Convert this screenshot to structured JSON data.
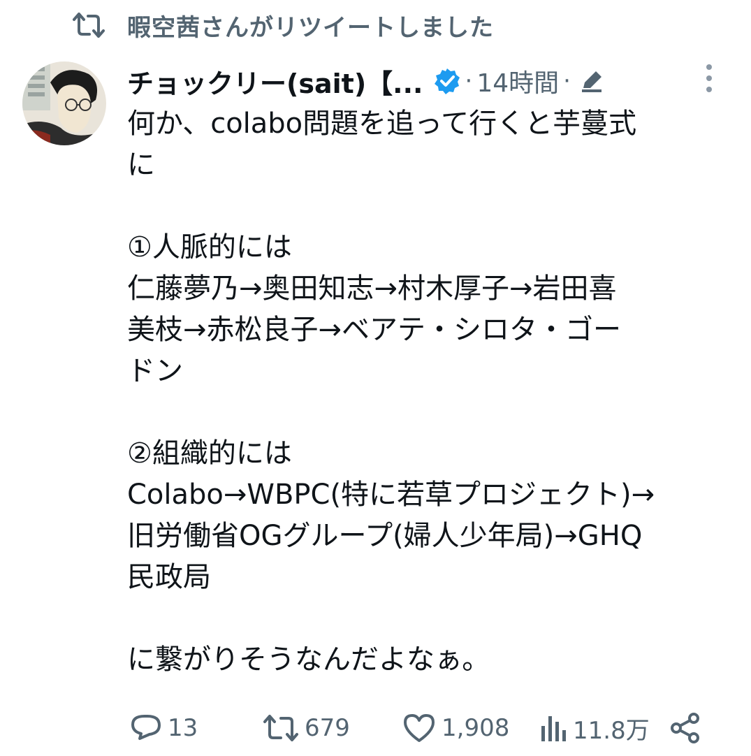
{
  "retweet_banner": {
    "icon": "retweet-icon",
    "text": "暇空茜さんがリツイートしました"
  },
  "tweet": {
    "author_name": "チョックリー(sait)【...",
    "verified": true,
    "separator": "·",
    "time": "14時間",
    "edited_icon": "pencil-icon",
    "more_icon": "more-vertical-icon",
    "lines": [
      "何か、colabo問題を追って行くと芋蔓式",
      "に",
      "",
      "①人脈的には",
      "仁藤夢乃→奥田知志→村木厚子→岩田喜",
      "美枝→赤松良子→ベアテ・シロタ・ゴー",
      "ドン",
      "",
      "②組織的には",
      "Colabo→WBPC(特に若草プロジェクト)→",
      "旧労働省OGグループ(婦人少年局)→GHQ",
      "民政局",
      "",
      "に繋がりそうなんだよなぁ。"
    ]
  },
  "actions": {
    "reply_count": "13",
    "retweet_count": "679",
    "like_count": "1,908",
    "views_count": "11.8万"
  },
  "colors": {
    "secondary_text": "#536471",
    "primary_text": "#0f1419",
    "verified_blue": "#1d9bf0"
  }
}
